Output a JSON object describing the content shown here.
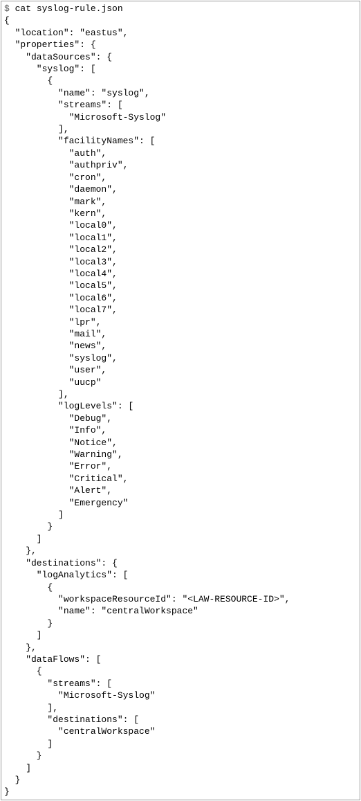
{
  "prompt": "$",
  "command": "cat syslog-rule.json",
  "file_content": {
    "location": "eastus",
    "properties": {
      "dataSources": {
        "syslog": [
          {
            "name": "syslog",
            "streams": [
              "Microsoft-Syslog"
            ],
            "facilityNames": [
              "auth",
              "authpriv",
              "cron",
              "daemon",
              "mark",
              "kern",
              "local0",
              "local1",
              "local2",
              "local3",
              "local4",
              "local5",
              "local6",
              "local7",
              "lpr",
              "mail",
              "news",
              "syslog",
              "user",
              "uucp"
            ],
            "logLevels": [
              "Debug",
              "Info",
              "Notice",
              "Warning",
              "Error",
              "Critical",
              "Alert",
              "Emergency"
            ]
          }
        ]
      },
      "destinations": {
        "logAnalytics": [
          {
            "workspaceResourceId": "<LAW-RESOURCE-ID>",
            "name": "centralWorkspace"
          }
        ]
      },
      "dataFlows": [
        {
          "streams": [
            "Microsoft-Syslog"
          ],
          "destinations": [
            "centralWorkspace"
          ]
        }
      ]
    }
  }
}
